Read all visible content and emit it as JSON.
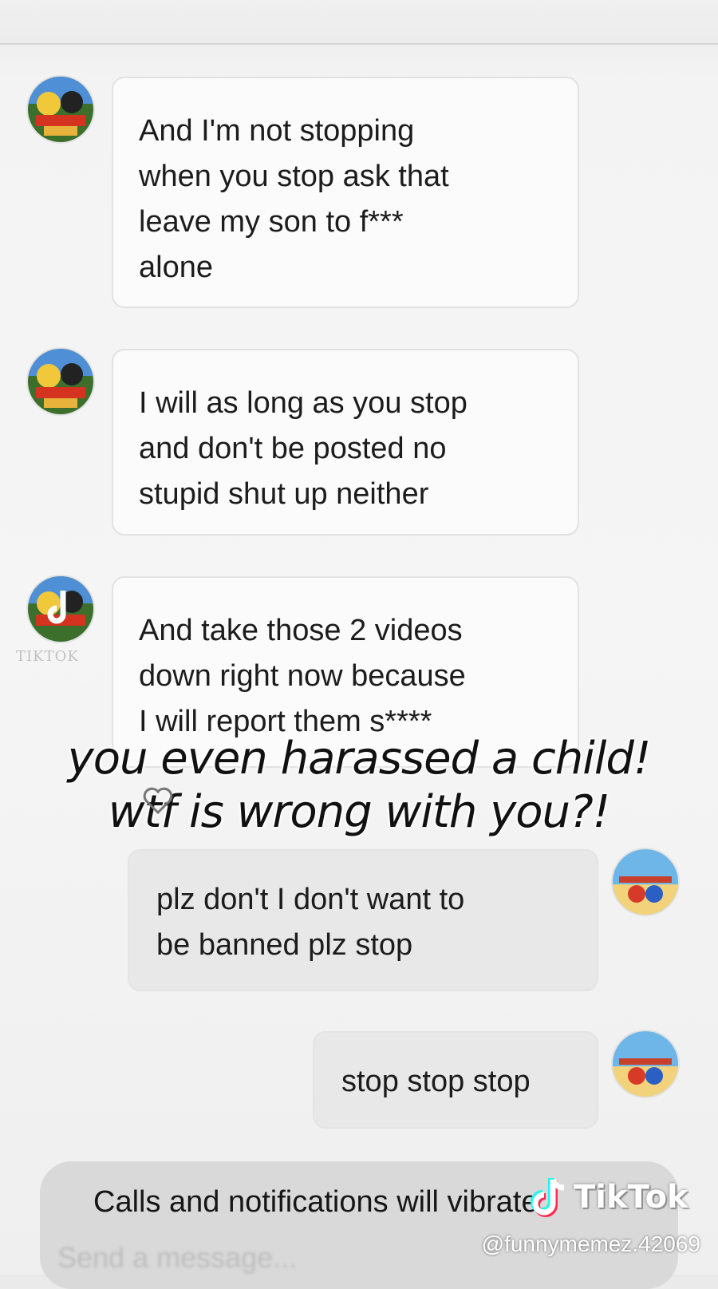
{
  "messages": [
    {
      "side": "in",
      "text_lines": [
        "And I'm not stopping",
        "when you stop ask that",
        "leave my son to f***",
        "alone"
      ]
    },
    {
      "side": "in",
      "text_lines": [
        "I will as long as you stop",
        "and don't be posted no",
        "stupid shut up neither"
      ]
    },
    {
      "side": "in",
      "text_lines": [
        "And take those 2 videos",
        "down right now because",
        "I will report them s****"
      ]
    },
    {
      "side": "out",
      "text_lines": [
        "plz don't I don't want to",
        "be banned plz stop"
      ]
    },
    {
      "side": "out",
      "text_lines": [
        "stop stop stop"
      ]
    }
  ],
  "overlay_caption": {
    "line1": "you even harassed a child!",
    "line2": "wtf is wrong with you?!"
  },
  "notification_bar": {
    "text": "Calls and notifications will vibrate",
    "input_placeholder": "Send a message..."
  },
  "watermark": {
    "brand": "TikTok",
    "handle": "@funnymemez.42069",
    "small_brand": "TIKTOK"
  },
  "colors": {
    "incoming_bubble": "#fbfbfb",
    "outgoing_bubble": "#e8e8e8",
    "background": "#f4f4f4"
  }
}
